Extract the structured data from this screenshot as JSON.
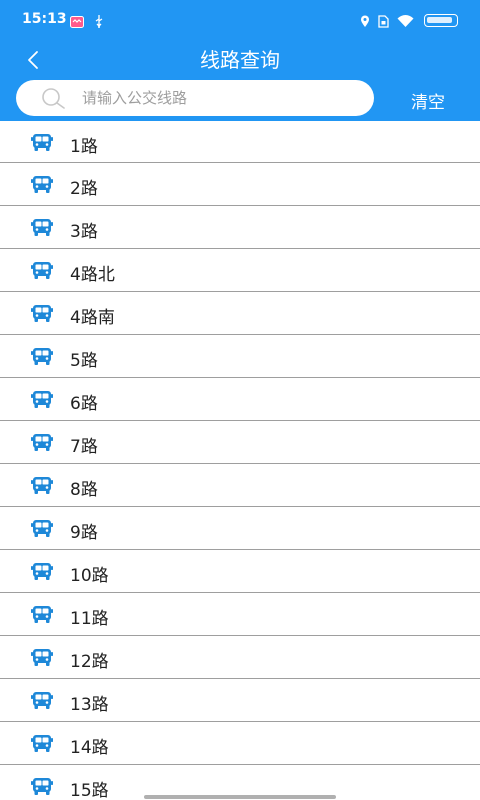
{
  "status_bar": {
    "time": "15:13",
    "battery_level": 0.9
  },
  "header": {
    "title": "线路查询",
    "back_icon": "chevron-left-icon"
  },
  "search": {
    "placeholder": "请输入公交线路",
    "value": "",
    "icon": "search-icon",
    "clear_label": "清空"
  },
  "routes": [
    {
      "name": "1路"
    },
    {
      "name": "2路"
    },
    {
      "name": "3路"
    },
    {
      "name": "4路北"
    },
    {
      "name": "4路南"
    },
    {
      "name": "5路"
    },
    {
      "name": "6路"
    },
    {
      "name": "7路"
    },
    {
      "name": "8路"
    },
    {
      "name": "9路"
    },
    {
      "name": "10路"
    },
    {
      "name": "11路"
    },
    {
      "name": "12路"
    },
    {
      "name": "13路"
    },
    {
      "name": "14路"
    },
    {
      "name": "15路"
    }
  ],
  "colors": {
    "primary": "#2196f3",
    "bus_icon": "#1e88d8",
    "divider": "#9e9e9e"
  }
}
